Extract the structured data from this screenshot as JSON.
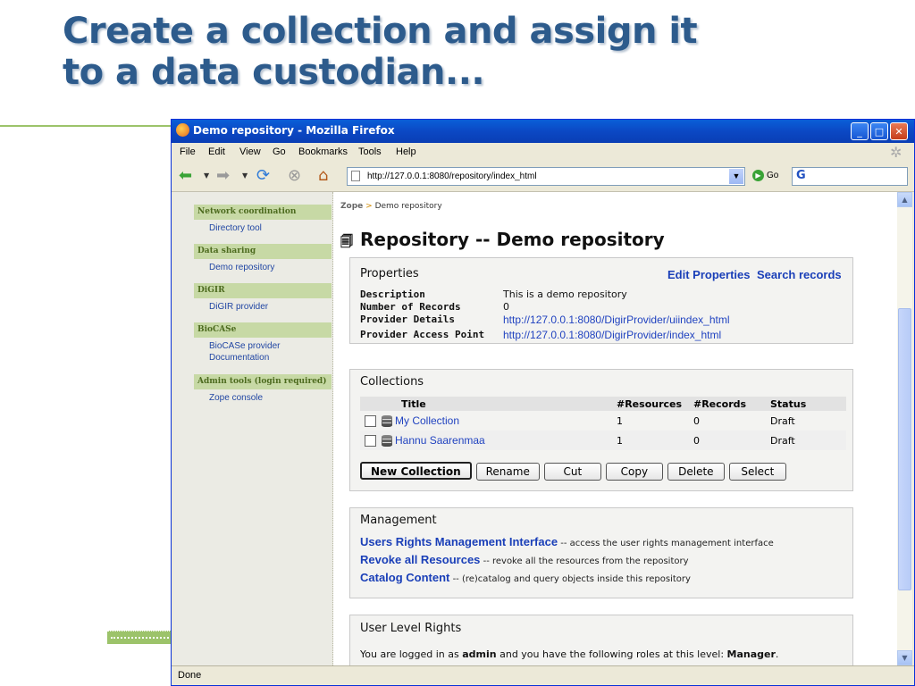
{
  "slide": {
    "title_line1": "Create a collection and assign it",
    "title_line2": "to a data custodian..."
  },
  "browser": {
    "window_title": "Demo repository - Mozilla Firefox",
    "menus": [
      "File",
      "Edit",
      "View",
      "Go",
      "Bookmarks",
      "Tools",
      "Help"
    ],
    "url": "http://127.0.0.1:8080/repository/index_html",
    "go_label": "Go",
    "search_glyph": "G",
    "status": "Done"
  },
  "sidebar": {
    "groups": [
      {
        "heading": "Network coordination",
        "items": [
          "Directory tool"
        ]
      },
      {
        "heading": "Data sharing",
        "items": [
          "Demo repository"
        ]
      },
      {
        "heading": "DiGIR",
        "items": [
          "DiGIR provider"
        ]
      },
      {
        "heading": "BioCASe",
        "items": [
          "BioCASe provider",
          "Documentation"
        ]
      },
      {
        "heading": "Admin tools (login required)",
        "items": [
          "Zope console"
        ]
      }
    ]
  },
  "breadcrumb": {
    "root": "Zope",
    "separator": ">",
    "current": "Demo repository"
  },
  "page": {
    "title": "Repository -- Demo repository"
  },
  "properties": {
    "heading": "Properties",
    "edit_link": "Edit Properties",
    "search_link": "Search records",
    "rows": [
      {
        "label": "Description",
        "value": "This is a demo repository"
      },
      {
        "label": "Number of Records",
        "value": "0"
      },
      {
        "label": "Provider Details",
        "value": "http://127.0.0.1:8080/DigirProvider/uiindex_html"
      },
      {
        "label": "Provider Access Point",
        "value": "http://127.0.0.1:8080/DigirProvider/index_html"
      }
    ]
  },
  "collections": {
    "heading": "Collections",
    "columns": [
      "Title",
      "#Resources",
      "#Records",
      "Status"
    ],
    "rows": [
      {
        "title": "My Collection",
        "resources": "1",
        "records": "0",
        "status": "Draft"
      },
      {
        "title": "Hannu Saarenmaa",
        "resources": "1",
        "records": "0",
        "status": "Draft"
      }
    ],
    "buttons": [
      "New Collection",
      "Rename",
      "Cut",
      "Copy",
      "Delete",
      "Select"
    ]
  },
  "management": {
    "heading": "Management",
    "lines": [
      {
        "link": "Users Rights Management Interface",
        "text": " -- access the user rights management interface"
      },
      {
        "link": "Revoke all Resources",
        "text": " -- revoke all the resources from the repository"
      },
      {
        "link": "Catalog Content",
        "text": " -- (re)catalog and query objects inside this repository"
      }
    ]
  },
  "user_rights": {
    "heading": "User Level Rights",
    "text_before": "You are logged in as ",
    "user": "admin",
    "text_middle": " and you have the following roles at this level: ",
    "role": "Manager",
    "text_after": "."
  },
  "colors": {
    "title": "#2d5b8c",
    "accent_green": "#9cc36a",
    "link": "#2143c0",
    "titlebar": "#0a48c4"
  }
}
